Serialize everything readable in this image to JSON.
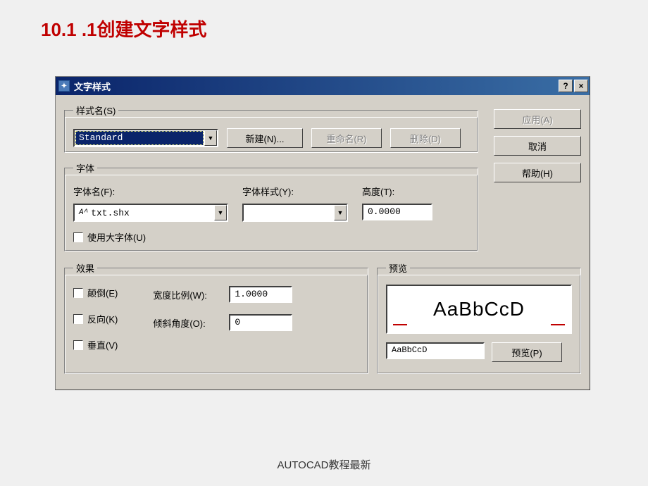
{
  "page": {
    "title": "10.1 .1创建文字样式",
    "footer": "AUTOCAD教程最新"
  },
  "dialog": {
    "title": "文字样式",
    "help_btn": "?",
    "close_btn": "×"
  },
  "styleName": {
    "legend": "样式名(S)",
    "selected": "Standard",
    "new_btn": "新建(N)...",
    "rename_btn": "重命名(R)",
    "delete_btn": "删除(D)"
  },
  "sideButtons": {
    "apply": "应用(A)",
    "cancel": "取消",
    "help": "帮助(H)"
  },
  "font": {
    "legend": "字体",
    "name_label": "字体名(F):",
    "name_value": "txt.shx",
    "style_label": "字体样式(Y):",
    "style_value": "",
    "height_label": "高度(T):",
    "height_value": "0.0000",
    "bigfont_label": "使用大字体(U)"
  },
  "effects": {
    "legend": "效果",
    "upside_down": "颠倒(E)",
    "backwards": "反向(K)",
    "vertical": "垂直(V)",
    "width_label": "宽度比例(W):",
    "width_value": "1.0000",
    "oblique_label": "倾斜角度(O):",
    "oblique_value": "0"
  },
  "preview": {
    "legend": "预览",
    "sample": "AaBbCcD",
    "input_value": "AaBbCcD",
    "preview_btn": "预览(P)"
  }
}
